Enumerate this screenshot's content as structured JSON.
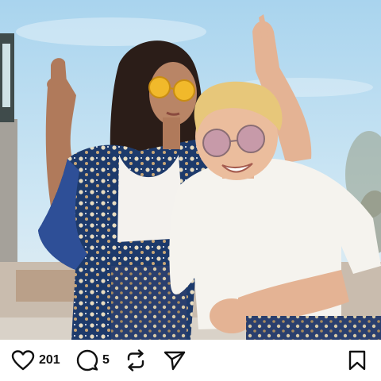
{
  "post": {
    "image": {
      "icon": "photo-of-two-people-wearing-sunglasses"
    },
    "actions": {
      "like": {
        "icon": "heart-icon",
        "count": "201"
      },
      "comment": {
        "icon": "comment-bubble-icon",
        "count": "5"
      },
      "repost": {
        "icon": "repost-icon"
      },
      "share": {
        "icon": "send-icon"
      },
      "save": {
        "icon": "bookmark-icon"
      }
    }
  },
  "colors": {
    "sky": "#b8dbef",
    "text": "#111111",
    "background": "#ffffff"
  }
}
